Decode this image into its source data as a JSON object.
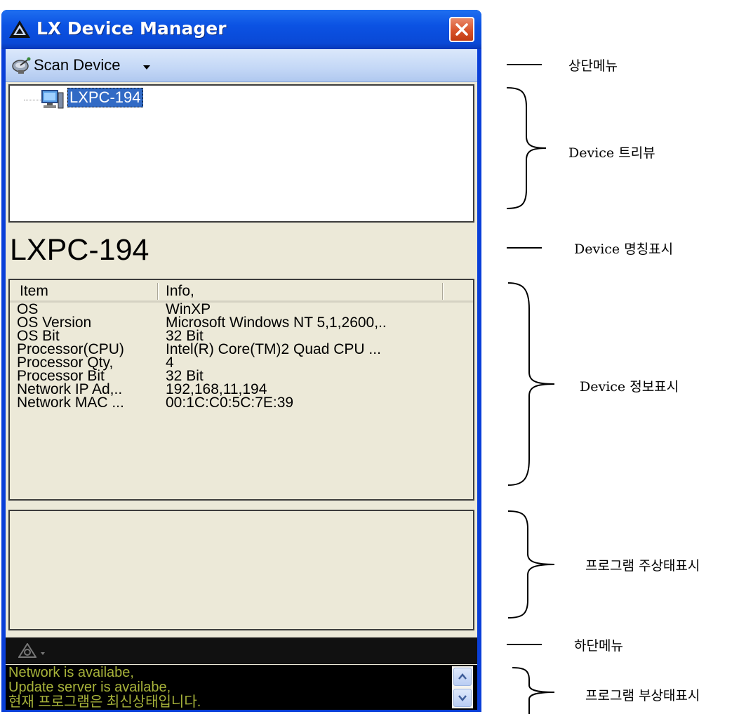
{
  "window": {
    "title": "LX Device Manager"
  },
  "top_menu": {
    "scan_label": "Scan Device"
  },
  "tree": {
    "selected_node": "LXPC-194"
  },
  "device_name": "LXPC-194",
  "info_list": {
    "columns": [
      "Item",
      "Info,"
    ],
    "rows": [
      {
        "item": "OS",
        "info": "WinXP"
      },
      {
        "item": "OS Version",
        "info": "Microsoft Windows NT 5,1,2600,.."
      },
      {
        "item": "OS Bit",
        "info": "32 Bit"
      },
      {
        "item": "Processor(CPU)",
        "info": "Intel(R) Core(TM)2 Quad CPU ..."
      },
      {
        "item": "Processor Qty,",
        "info": "4"
      },
      {
        "item": "Processor Bit",
        "info": "32 Bit"
      },
      {
        "item": "Network IP Ad,..",
        "info": "192,168,11,194"
      },
      {
        "item": "Network MAC ...",
        "info": "00:1C:C0:5C:7E:39"
      }
    ]
  },
  "sub_status": {
    "lines": [
      "Network is availabe,",
      "Update server is availabe,",
      "현재 프로그램은 최신상태입니다."
    ],
    "text_color": "#a7b23a"
  },
  "annotations": {
    "top_menu": "상단메뉴",
    "tree_view": "Device 트리뷰",
    "name_display": "Device 명칭표시",
    "info_display": "Device 정보표시",
    "main_status": "프로그램 주상태표시",
    "bottom_menu": "하단메뉴",
    "sub_status": "프로그램 부상태표시"
  },
  "colors": {
    "titlebar": "#0a49d6",
    "window_bg": "#ece9d8",
    "selection": "#316ac5",
    "close_button": "#d8532a"
  }
}
